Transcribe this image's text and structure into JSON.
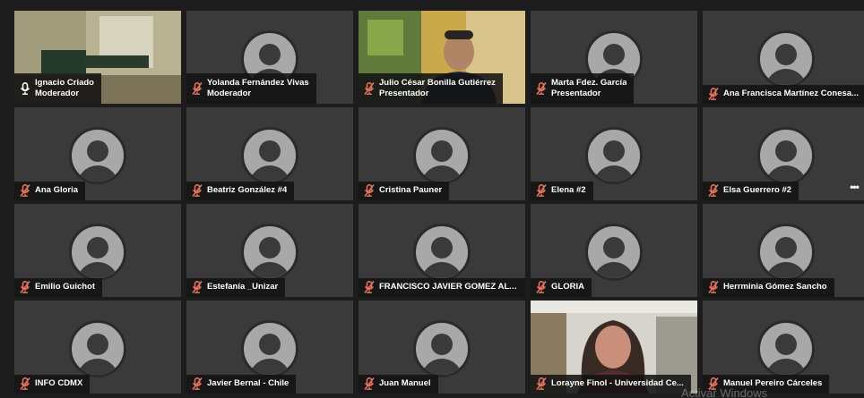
{
  "participants": [
    {
      "name": "Ignacio Criado",
      "role": "Moderador",
      "muted": false,
      "video": "room",
      "active": true
    },
    {
      "name": "Yolanda Fernández Vivas",
      "role": "Moderador",
      "muted": true,
      "video": null,
      "active": false
    },
    {
      "name": "Julio César Bonilla Gutiérrez",
      "role": "Presentador",
      "muted": true,
      "video": "man",
      "active": false
    },
    {
      "name": "Marta Fdez. García",
      "role": "Presentador",
      "muted": true,
      "video": null,
      "active": false
    },
    {
      "name": "Ana Francisca Martínez Conesa...",
      "role": "",
      "muted": true,
      "video": null,
      "active": false
    },
    {
      "name": "Ana Gloria",
      "role": "",
      "muted": true,
      "video": null,
      "active": false
    },
    {
      "name": "Beatriz González #4",
      "role": "",
      "muted": true,
      "video": null,
      "active": false
    },
    {
      "name": "Cristina Pauner",
      "role": "",
      "muted": true,
      "video": null,
      "active": false
    },
    {
      "name": "Elena #2",
      "role": "",
      "muted": true,
      "video": null,
      "active": false
    },
    {
      "name": "Elsa Guerrero #2",
      "role": "",
      "muted": true,
      "video": null,
      "active": false
    },
    {
      "name": "Emilio Guichot",
      "role": "",
      "muted": true,
      "video": null,
      "active": false
    },
    {
      "name": "Estefanía _Unizar",
      "role": "",
      "muted": true,
      "video": null,
      "active": false
    },
    {
      "name": "FRANCISCO JAVIER GOMEZ ALV...",
      "role": "",
      "muted": true,
      "video": null,
      "active": false
    },
    {
      "name": "GLORIA",
      "role": "",
      "muted": true,
      "video": null,
      "active": false
    },
    {
      "name": "Herrminia Gómez Sancho",
      "role": "",
      "muted": true,
      "video": null,
      "active": false
    },
    {
      "name": "INFO CDMX",
      "role": "",
      "muted": true,
      "video": null,
      "active": false
    },
    {
      "name": "Javier Bernal - Chile",
      "role": "",
      "muted": true,
      "video": null,
      "active": false
    },
    {
      "name": "Juan Manuel",
      "role": "",
      "muted": true,
      "video": null,
      "active": false
    },
    {
      "name": "Lorayne Finol - Universidad Ce...",
      "role": "",
      "muted": true,
      "video": "woman",
      "active": false
    },
    {
      "name": "Manuel Pereiro Cárceles",
      "role": "",
      "muted": true,
      "video": null,
      "active": false
    }
  ],
  "more_options_label": "•••",
  "watermark": "Activar Windows",
  "colors": {
    "background": "#1c1c1c",
    "tile": "#3a3a3a",
    "muted_icon": "#e8735a",
    "active_border": "#e8735a"
  }
}
